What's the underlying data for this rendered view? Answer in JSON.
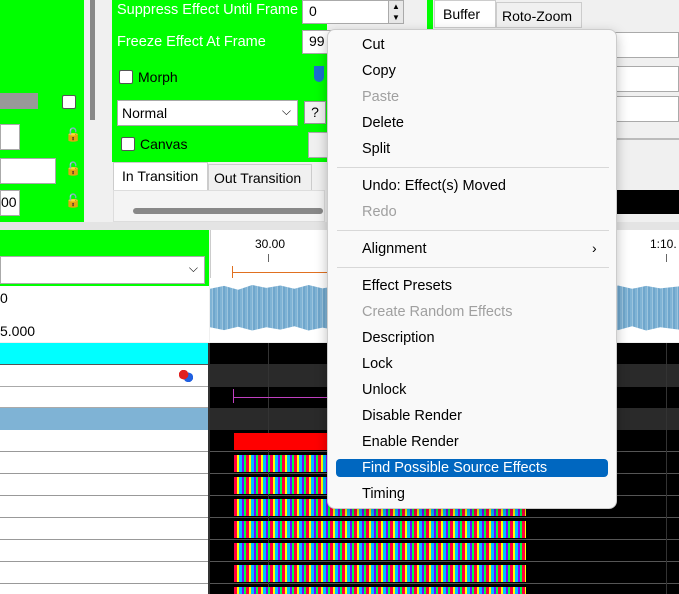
{
  "left_panel": {
    "lock_icon": "lock-icon",
    "field_3_value": "00"
  },
  "effect_settings": {
    "suppress_label": "Suppress Effect Until Frame",
    "suppress_value": "0",
    "freeze_label": "Freeze Effect At Frame",
    "freeze_value": "99",
    "morph_label": "Morph",
    "blend_value": "Normal",
    "help_label": "?",
    "canvas_label": "Canvas",
    "tabs": [
      "In Transition",
      "Out Transition"
    ]
  },
  "right_panel": {
    "tabs": [
      "Buffer",
      "Roto-Zoom"
    ]
  },
  "timeline": {
    "time_ticks": [
      "30.00",
      "1:10."
    ],
    "row_value_top": "0",
    "row_value_bottom": "5.000"
  },
  "context_menu": {
    "items": [
      {
        "label": "Cut",
        "enabled": true
      },
      {
        "label": "Copy",
        "enabled": true
      },
      {
        "label": "Paste",
        "enabled": false
      },
      {
        "label": "Delete",
        "enabled": true
      },
      {
        "label": "Split",
        "enabled": true
      },
      {
        "label": "Undo: Effect(s) Moved",
        "enabled": true
      },
      {
        "label": "Redo",
        "enabled": false
      },
      {
        "label": "Alignment",
        "enabled": true
      },
      {
        "label": "Effect Presets",
        "enabled": true
      },
      {
        "label": "Create Random Effects",
        "enabled": false
      },
      {
        "label": "Description",
        "enabled": true
      },
      {
        "label": "Lock",
        "enabled": true
      },
      {
        "label": "Unlock",
        "enabled": true
      },
      {
        "label": "Disable Render",
        "enabled": true
      },
      {
        "label": "Enable Render",
        "enabled": true
      },
      {
        "label": "Find Possible Source Effects",
        "enabled": true,
        "highlighted": true
      },
      {
        "label": "Timing",
        "enabled": true
      }
    ],
    "submenu_arrow": "chevron-right-icon"
  },
  "colors": {
    "panel_green": "#00ff00",
    "highlight_blue": "#0067c0",
    "cyan_row": "#00ffff",
    "selected_row_blue": "#7fb3d5",
    "effect_red": "#ff0000"
  }
}
